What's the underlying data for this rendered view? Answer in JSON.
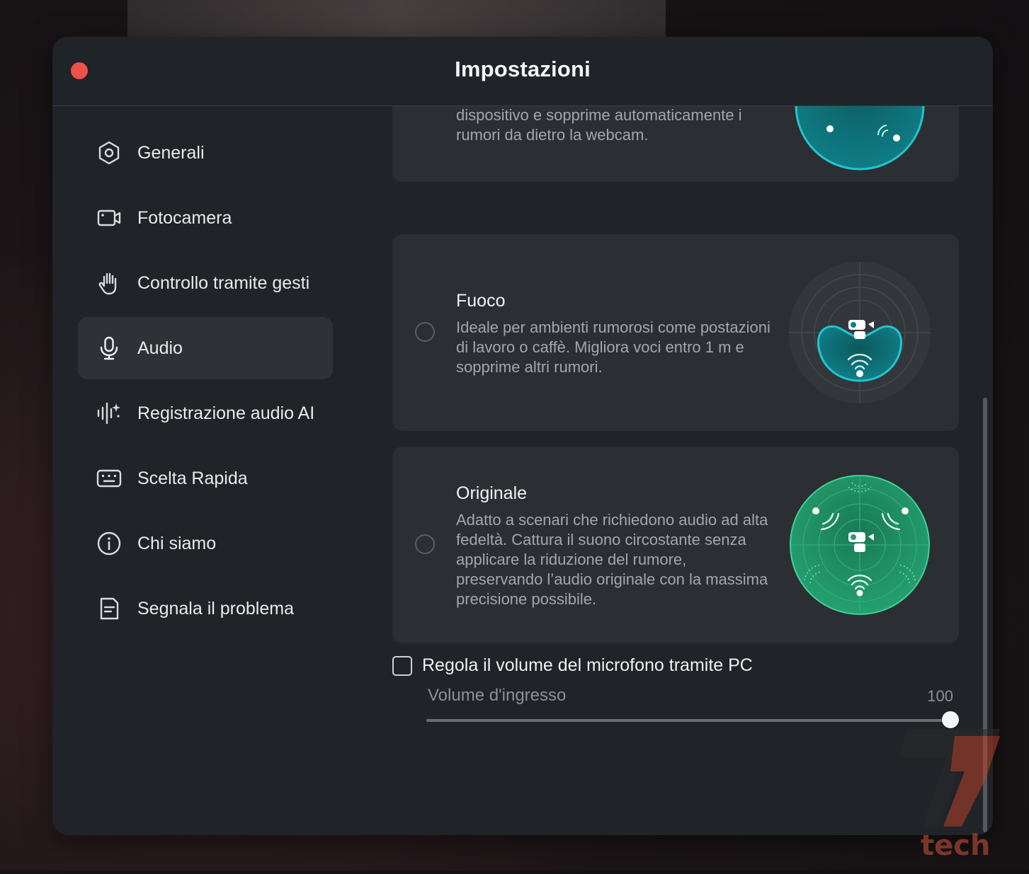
{
  "window": {
    "title": "Impostazioni"
  },
  "sidebar": {
    "items": [
      {
        "label": "Generali",
        "icon": "hexagon-settings-icon"
      },
      {
        "label": "Fotocamera",
        "icon": "camera-icon"
      },
      {
        "label": "Controllo tramite gesti",
        "icon": "hand-icon"
      },
      {
        "label": "Audio",
        "icon": "microphone-icon",
        "active": true
      },
      {
        "label": "Registrazione audio AI",
        "icon": "ai-waveform-icon"
      },
      {
        "label": "Scelta Rapida",
        "icon": "keyboard-icon"
      },
      {
        "label": "Chi siamo",
        "icon": "info-icon"
      },
      {
        "label": "Segnala il problema",
        "icon": "report-icon"
      }
    ]
  },
  "modes": {
    "partial": {
      "desc": "dispositivo e sopprime automaticamente i rumori da dietro la webcam."
    },
    "fuoco": {
      "title": "Fuoco",
      "desc": "Ideale per ambienti rumorosi come postazioni di lavoro o caffè. Migliora voci entro 1 m e sopprime altri rumori."
    },
    "originale": {
      "title": "Originale",
      "desc": "Adatto a scenari che richiedono audio ad alta fedeltà. Cattura il suono circostante senza applicare la riduzione del rumore, preservando l’audio originale con la massima precisione possibile."
    }
  },
  "mic_volume": {
    "checkbox_label": "Regola il volume del microfono tramite PC",
    "checked": false,
    "input_label": "Volume d'ingresso",
    "value": "100",
    "fraction": 1.0
  },
  "watermark": {
    "text": "tech"
  },
  "colors": {
    "close": "#ed5148",
    "teal": "#1aa3a8",
    "green": "#2a9a6c",
    "background": "#202327"
  }
}
